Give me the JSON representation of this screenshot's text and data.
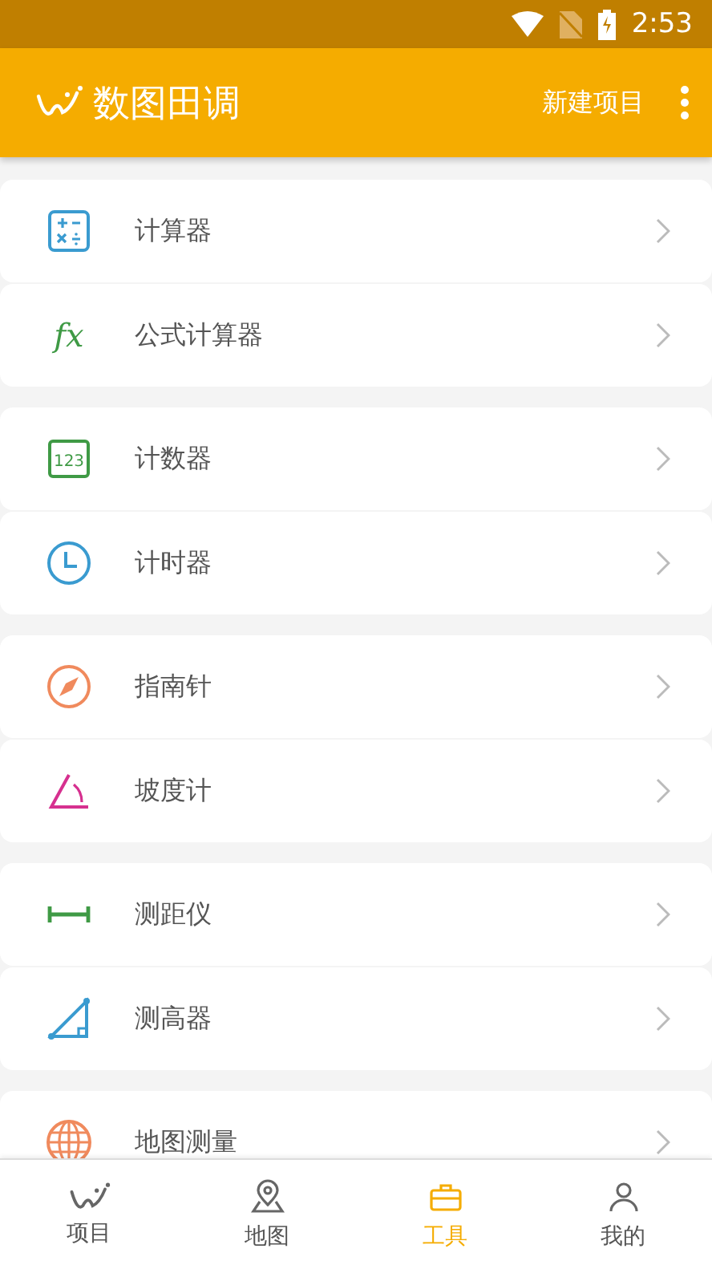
{
  "status_bar": {
    "time": "2:53"
  },
  "app_bar": {
    "title": "数图田调",
    "action": "新建项目"
  },
  "groups": [
    {
      "items": [
        {
          "label": "计算器",
          "kind": "calculator"
        },
        {
          "label": "公式计算器",
          "kind": "formula",
          "icon_text": "fx"
        }
      ]
    },
    {
      "items": [
        {
          "label": "计数器",
          "kind": "counter",
          "icon_text": "123"
        },
        {
          "label": "计时器",
          "kind": "clock"
        }
      ]
    },
    {
      "items": [
        {
          "label": "指南针",
          "kind": "compass"
        },
        {
          "label": "坡度计",
          "kind": "angle"
        }
      ]
    },
    {
      "items": [
        {
          "label": "测距仪",
          "kind": "ruler"
        },
        {
          "label": "测高器",
          "kind": "triangle"
        }
      ]
    },
    {
      "items": [
        {
          "label": "地图测量",
          "kind": "globe"
        }
      ]
    }
  ],
  "tabs": [
    {
      "label": "项目",
      "kind": "logo",
      "selected": false
    },
    {
      "label": "地图",
      "kind": "pin",
      "selected": false
    },
    {
      "label": "工具",
      "kind": "tools",
      "selected": true
    },
    {
      "label": "我的",
      "kind": "person",
      "selected": false
    }
  ]
}
